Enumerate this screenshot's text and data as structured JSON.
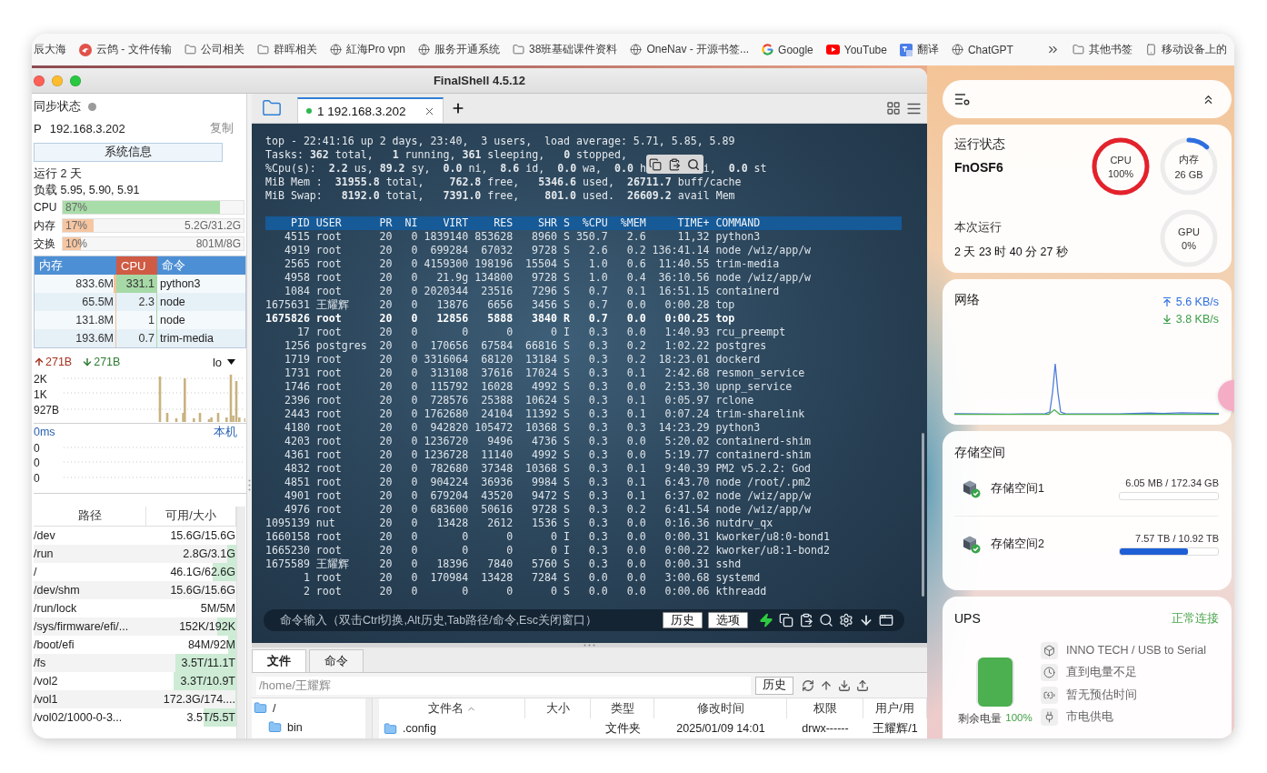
{
  "bookmarks": {
    "items": [
      {
        "label": "辰大海",
        "kind": "text"
      },
      {
        "label": "云鸽 - 文件传输",
        "kind": "bird"
      },
      {
        "label": "公司相关",
        "kind": "folder"
      },
      {
        "label": "群晖相关",
        "kind": "folder"
      },
      {
        "label": "紅海Pro vpn",
        "kind": "globe"
      },
      {
        "label": "服务开通系统",
        "kind": "globe"
      },
      {
        "label": "38班基础课件资料",
        "kind": "folder"
      },
      {
        "label": "OneNav - 开源书签...",
        "kind": "globe"
      },
      {
        "label": "Google",
        "kind": "g"
      },
      {
        "label": "YouTube",
        "kind": "play"
      },
      {
        "label": "翻译",
        "kind": "translate"
      },
      {
        "label": "ChatGPT",
        "kind": "globe"
      }
    ],
    "overflow": [
      {
        "label": "其他书签",
        "kind": "folder"
      },
      {
        "label": "移动设备上的",
        "kind": "phone"
      }
    ]
  },
  "window": {
    "title": "FinalShell 4.5.12"
  },
  "sidebar": {
    "sync_label": "同步状态",
    "sync_on": false,
    "ip_label": "P",
    "ip": "192.168.3.202",
    "copy": "复制",
    "info_button": "系统信息",
    "uptime": "运行 2 天",
    "load": "负载 5.95, 5.90, 5.91",
    "meters": [
      {
        "label": "CPU",
        "percent": "87%",
        "level": 0.87,
        "kind": "cpu"
      },
      {
        "label": "内存",
        "percent": "17%",
        "detail": "5.2G/31.2G",
        "level": 0.17,
        "kind": "memory"
      },
      {
        "label": "交换",
        "percent": "10%",
        "detail": "801M/8G",
        "level": 0.1,
        "kind": "memory"
      }
    ],
    "processes": {
      "columns": [
        {
          "label": "内存",
          "selected": false
        },
        {
          "label": "CPU",
          "selected": true
        },
        {
          "label": "命令",
          "selected": false
        }
      ],
      "rows": [
        {
          "memory": "833.6M",
          "memory_bar": {
            "level": 0.03
          },
          "cpu": "331.1",
          "cpu_bar": {
            "level": 1
          },
          "command": "python3"
        },
        {
          "memory": "65.5M",
          "memory_bar": {
            "level": 0.01
          },
          "cpu": "2.3",
          "cpu_bar": {
            "level": 0.02
          },
          "command": "node"
        },
        {
          "memory": "131.8M",
          "memory_bar": {
            "level": 0.01
          },
          "cpu": "1",
          "cpu_bar": {
            "level": 0.01
          },
          "command": "node"
        },
        {
          "memory": "193.6M",
          "memory_bar": {
            "level": 0.01
          },
          "cpu": "0.7",
          "cpu_bar": {
            "level": 0.01
          },
          "command": "trim-media"
        }
      ]
    },
    "network": {
      "up": "271B",
      "down": "271B",
      "interface": "lo",
      "axis_labels": [
        "2K",
        "1K",
        "927B"
      ]
    },
    "ping": {
      "latency": "0ms",
      "host": "本机",
      "axis_labels": [
        "0",
        "0",
        "0"
      ]
    },
    "disks": {
      "columns": [
        "路径",
        "可用/大小"
      ],
      "rows": [
        {
          "path": "/dev",
          "usage": "15.6G/15.6G"
        },
        {
          "path": "/run",
          "usage": "2.8G/3.1G",
          "level": 0.1
        },
        {
          "path": "/",
          "usage": "46.1G/62.6G",
          "level": 0.26
        },
        {
          "path": "/dev/shm",
          "usage": "15.6G/15.6G"
        },
        {
          "path": "/run/lock",
          "usage": "5M/5M"
        },
        {
          "path": "/sys/firmware/efi/...",
          "usage": "152K/192K",
          "level": 0.21
        },
        {
          "path": "/boot/efi",
          "usage": "84M/92M",
          "level": 0.09
        },
        {
          "path": "/fs",
          "usage": "3.5T/11.1T",
          "level": 0.68
        },
        {
          "path": "/vol2",
          "usage": "3.3T/10.9T",
          "level": 0.7
        },
        {
          "path": "/vol1",
          "usage": "172.3G/174....",
          "level": 0.01
        },
        {
          "path": "/vol02/1000-0-3...",
          "usage": "3.5T/5.5T",
          "level": 0.36
        }
      ]
    }
  },
  "session_tabs": [
    {
      "label": "1 192.168.3.202",
      "selected": true,
      "connected": true
    }
  ],
  "terminal": {
    "summary": [
      {
        "text": "top - 22:41:16 up 2 days, 23:40,  3 users,  load average: 5.71, 5.85, 5.89"
      },
      {
        "text": "Tasks: **362** total,   **1** running, **361** sleeping,   **0** stopped,"
      },
      {
        "text": "%Cpu(s):  **2.2** us, **89.2** sy,  **0.0** ni,  **8.6** id,  **0.0** wa,  **0.0** h",
        "text_after": "i,  **0.0** st"
      },
      {
        "text": "MiB Mem :  **31955.8** total,    **762.8** free,   **5346.6** used,  **26711.7** buff/cache"
      },
      {
        "text": "MiB Swap:   **8192.0** total,   **7391.0** free,    **801.0** used.  **26609.2** avail Mem"
      }
    ],
    "columns": [
      "PID",
      "USER",
      "PR",
      "NI",
      "VIRT",
      "RES",
      "SHR",
      "S",
      "%CPU",
      "%MEM",
      "TIME+",
      "COMMAND"
    ],
    "rows": [
      {
        "cells": [
          "4515",
          "root",
          "20",
          "0",
          "1839140",
          "853628",
          "8960",
          "S",
          "350.7",
          "2.6",
          "11,32",
          "python3"
        ],
        "bold": false
      },
      {
        "cells": [
          "4919",
          "root",
          "20",
          "0",
          "699284",
          "67032",
          "9728",
          "S",
          "2.6",
          "0.2",
          "136:41.14",
          "node /wiz/app/w"
        ],
        "bold": false
      },
      {
        "cells": [
          "2565",
          "root",
          "20",
          "0",
          "4159300",
          "198196",
          "15504",
          "S",
          "1.0",
          "0.6",
          "11:40.55",
          "trim-media"
        ],
        "bold": false
      },
      {
        "cells": [
          "4958",
          "root",
          "20",
          "0",
          "21.9g",
          "134800",
          "9728",
          "S",
          "1.0",
          "0.4",
          "36:10.56",
          "node /wiz/app/w"
        ],
        "bold": false
      },
      {
        "cells": [
          "1084",
          "root",
          "20",
          "0",
          "2020344",
          "23516",
          "7296",
          "S",
          "0.7",
          "0.1",
          "16:51.15",
          "containerd"
        ],
        "bold": false
      },
      {
        "cells": [
          "1675631",
          "王耀辉",
          "20",
          "0",
          "13876",
          "6656",
          "3456",
          "S",
          "0.7",
          "0.0",
          "0:00.28",
          "top"
        ],
        "bold": false
      },
      {
        "cells": [
          "1675826",
          "root",
          "20",
          "0",
          "12856",
          "5888",
          "3840",
          "R",
          "0.7",
          "0.0",
          "0:00.25",
          "top"
        ],
        "bold": true
      },
      {
        "cells": [
          "17",
          "root",
          "20",
          "0",
          "0",
          "0",
          "0",
          "I",
          "0.3",
          "0.0",
          "1:40.93",
          "rcu_preempt"
        ],
        "bold": false
      },
      {
        "cells": [
          "1256",
          "postgres",
          "20",
          "0",
          "170656",
          "67584",
          "66816",
          "S",
          "0.3",
          "0.2",
          "1:02.22",
          "postgres"
        ],
        "bold": false
      },
      {
        "cells": [
          "1719",
          "root",
          "20",
          "0",
          "3316064",
          "68120",
          "13184",
          "S",
          "0.3",
          "0.2",
          "18:23.01",
          "dockerd"
        ],
        "bold": false
      },
      {
        "cells": [
          "1731",
          "root",
          "20",
          "0",
          "313108",
          "37616",
          "17024",
          "S",
          "0.3",
          "0.1",
          "2:42.68",
          "resmon_service"
        ],
        "bold": false
      },
      {
        "cells": [
          "1746",
          "root",
          "20",
          "0",
          "115792",
          "16028",
          "4992",
          "S",
          "0.3",
          "0.0",
          "2:53.30",
          "upnp_service"
        ],
        "bold": false
      },
      {
        "cells": [
          "2396",
          "root",
          "20",
          "0",
          "728576",
          "25388",
          "10624",
          "S",
          "0.3",
          "0.1",
          "0:05.97",
          "rclone"
        ],
        "bold": false
      },
      {
        "cells": [
          "2443",
          "root",
          "20",
          "0",
          "1762680",
          "24104",
          "11392",
          "S",
          "0.3",
          "0.1",
          "0:07.24",
          "trim-sharelink"
        ],
        "bold": false
      },
      {
        "cells": [
          "4180",
          "root",
          "20",
          "0",
          "942820",
          "105472",
          "10368",
          "S",
          "0.3",
          "0.3",
          "14:23.29",
          "python3"
        ],
        "bold": false
      },
      {
        "cells": [
          "4203",
          "root",
          "20",
          "0",
          "1236720",
          "9496",
          "4736",
          "S",
          "0.3",
          "0.0",
          "5:20.02",
          "containerd-shim"
        ],
        "bold": false
      },
      {
        "cells": [
          "4361",
          "root",
          "20",
          "0",
          "1236728",
          "11140",
          "4992",
          "S",
          "0.3",
          "0.0",
          "5:19.77",
          "containerd-shim"
        ],
        "bold": false
      },
      {
        "cells": [
          "4832",
          "root",
          "20",
          "0",
          "782680",
          "37348",
          "10368",
          "S",
          "0.3",
          "0.1",
          "9:40.39",
          "PM2 v5.2.2: God"
        ],
        "bold": false
      },
      {
        "cells": [
          "4851",
          "root",
          "20",
          "0",
          "904224",
          "36936",
          "9984",
          "S",
          "0.3",
          "0.1",
          "6:43.70",
          "node /root/.pm2"
        ],
        "bold": false
      },
      {
        "cells": [
          "4901",
          "root",
          "20",
          "0",
          "679204",
          "43520",
          "9472",
          "S",
          "0.3",
          "0.1",
          "6:37.02",
          "node /wiz/app/w"
        ],
        "bold": false
      },
      {
        "cells": [
          "4976",
          "root",
          "20",
          "0",
          "683600",
          "50616",
          "9728",
          "S",
          "0.3",
          "0.2",
          "6:41.54",
          "node /wiz/app/w"
        ],
        "bold": false
      },
      {
        "cells": [
          "1095139",
          "nut",
          "20",
          "0",
          "13428",
          "2612",
          "1536",
          "S",
          "0.3",
          "0.0",
          "0:16.36",
          "nutdrv_qx"
        ],
        "bold": false
      },
      {
        "cells": [
          "1660158",
          "root",
          "20",
          "0",
          "0",
          "0",
          "0",
          "I",
          "0.3",
          "0.0",
          "0:00.31",
          "kworker/u8:0-bond1"
        ],
        "bold": false
      },
      {
        "cells": [
          "1665230",
          "root",
          "20",
          "0",
          "0",
          "0",
          "0",
          "I",
          "0.3",
          "0.0",
          "0:00.22",
          "kworker/u8:1-bond2"
        ],
        "bold": false
      },
      {
        "cells": [
          "1675589",
          "王耀辉",
          "20",
          "0",
          "18396",
          "7840",
          "5760",
          "S",
          "0.3",
          "0.0",
          "0:00.31",
          "sshd"
        ],
        "bold": false
      },
      {
        "cells": [
          "1",
          "root",
          "20",
          "0",
          "170984",
          "13428",
          "7284",
          "S",
          "0.0",
          "0.0",
          "3:00.68",
          "systemd"
        ],
        "bold": false
      },
      {
        "cells": [
          "2",
          "root",
          "20",
          "0",
          "0",
          "0",
          "0",
          "S",
          "0.0",
          "0.0",
          "0:00.06",
          "kthreadd"
        ],
        "bold": false
      }
    ],
    "command_bar": {
      "placeholder": "命令输入（双击Ctrl切换,Alt历史,Tab路径/命令,Esc关闭窗口）",
      "buttons": [
        "历史",
        "选项"
      ]
    }
  },
  "file_panel": {
    "tabs": [
      {
        "label": "文件",
        "selected": true
      },
      {
        "label": "命令",
        "selected": false
      }
    ],
    "path": "/home/王耀辉",
    "history_button": "历史",
    "tree": [
      {
        "label": "/",
        "children": [
          {
            "label": "bin"
          }
        ]
      }
    ],
    "columns": [
      {
        "label": "文件名",
        "sorted": true
      },
      {
        "label": "大小",
        "sorted": false
      },
      {
        "label": "类型",
        "sorted": false
      },
      {
        "label": "修改时间",
        "sorted": false
      },
      {
        "label": "权限",
        "sorted": false
      },
      {
        "label": "用户/用",
        "sorted": false
      }
    ],
    "rows": [
      {
        "name": ".config",
        "type": "文件夹",
        "modified": "2025/01/09 14:01",
        "permissions": "drwx------",
        "owner": "王耀辉/1"
      }
    ]
  },
  "widgets": {
    "status": {
      "title": "运行状态",
      "host": "FnOSF6",
      "rings": [
        {
          "label": "CPU",
          "value": "100%",
          "level": 1
        },
        {
          "label": "内存",
          "value": "26 GB",
          "level": 0.12
        },
        {
          "label": "GPU",
          "value": "0%"
        }
      ],
      "uptime_label": "本次运行",
      "uptime": "2 天 23 时 40 分 27 秒"
    },
    "network": {
      "title": "网络",
      "upload": "5.6 KB/s",
      "download": "3.8 KB/s"
    },
    "storage": {
      "title": "存储空间",
      "volumes": [
        {
          "name": "存储空间1",
          "usage": "6.05 MB / 172.34 GB",
          "healthy": true
        },
        {
          "name": "存储空间2",
          "usage": "7.57 TB / 10.92 TB",
          "level": 0.69,
          "healthy": true
        }
      ]
    },
    "ups": {
      "title": "UPS",
      "status": "正常连接",
      "battery_label": "剩余电量",
      "battery_value": "100%",
      "level": 1,
      "details": [
        {
          "kind": "device",
          "text": "INNO TECH / USB to Serial"
        },
        {
          "kind": "clock",
          "text": "直到电量不足"
        },
        {
          "kind": "estimate",
          "text": "暂无预估时间"
        },
        {
          "kind": "power",
          "text": "市电供电"
        }
      ]
    }
  }
}
